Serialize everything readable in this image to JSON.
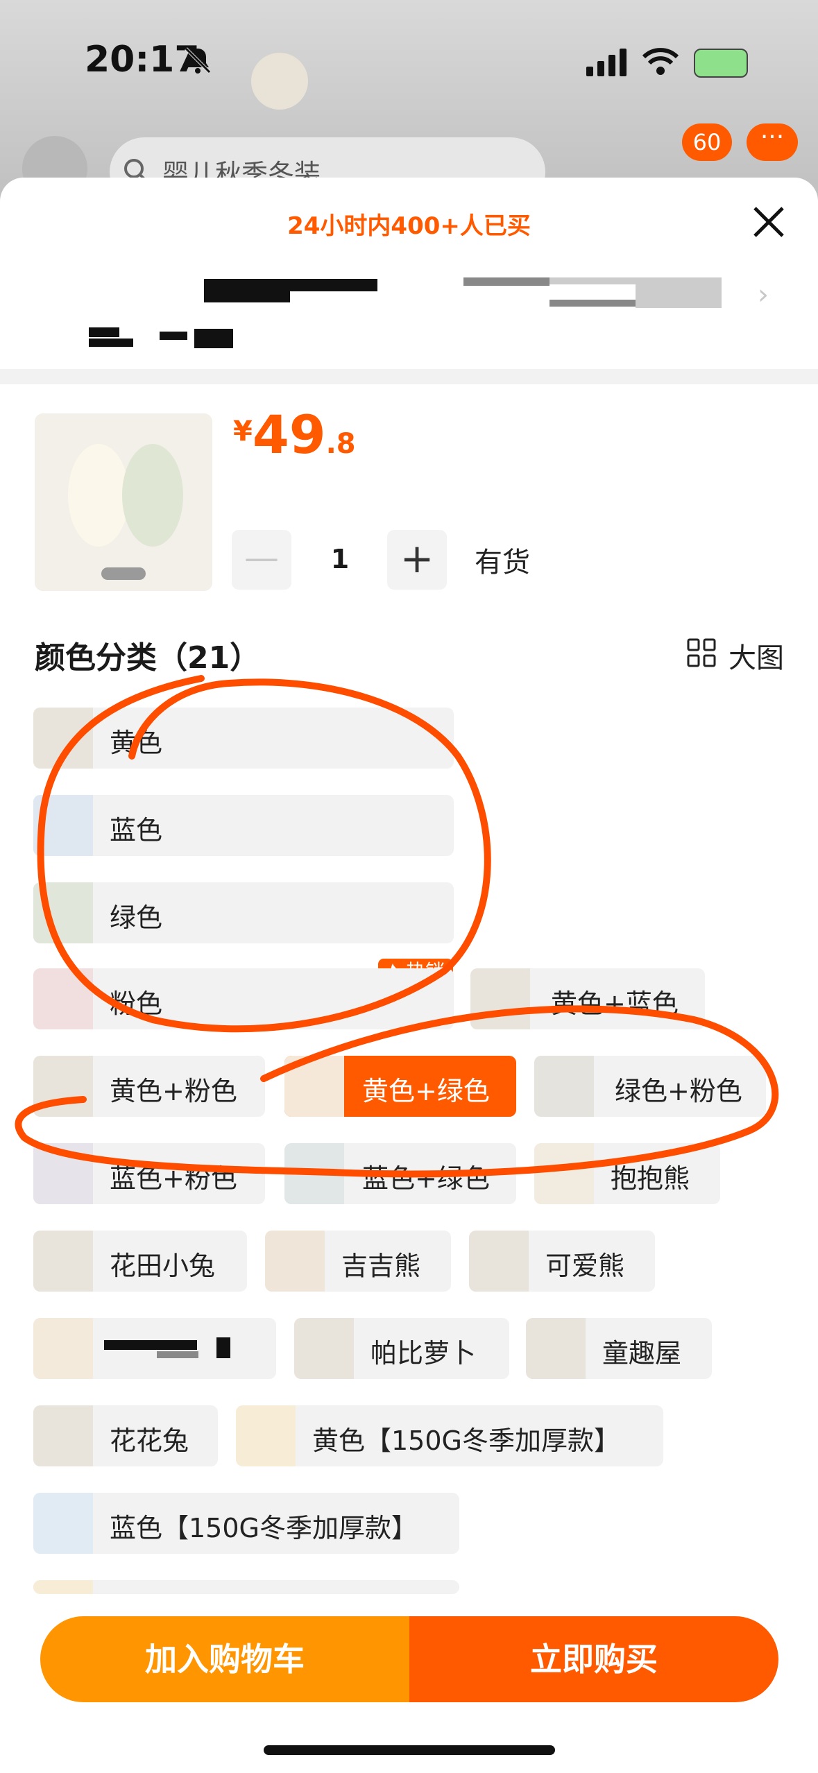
{
  "status_bar": {
    "time": "20:17"
  },
  "background_app": {
    "search_text": "婴儿秋季冬装",
    "cart_count": "60",
    "more": "···"
  },
  "sheet": {
    "banner": "24小时内400+人已买",
    "price": {
      "currency": "¥",
      "integer": "49",
      "decimal": ".8"
    },
    "product_thumb_label": "黄色+绿色",
    "quantity": "1",
    "stock": "有货",
    "section_title": "颜色分类（21）",
    "big_image_label": "大图",
    "hot_badge": "热销",
    "options": [
      {
        "label": "黄色"
      },
      {
        "label": "蓝色"
      },
      {
        "label": "绿色"
      },
      {
        "label": "粉色"
      },
      {
        "label": "黄色+蓝色"
      },
      {
        "label": "黄色+粉色"
      },
      {
        "label": "黄色+绿色",
        "selected": true
      },
      {
        "label": "绿色+粉色"
      },
      {
        "label": "蓝色+粉色"
      },
      {
        "label": "蓝色+绿色"
      },
      {
        "label": "抱抱熊"
      },
      {
        "label": "花田小兔"
      },
      {
        "label": "吉吉熊"
      },
      {
        "label": "可爱熊"
      },
      {
        "label": ""
      },
      {
        "label": "帕比萝卜"
      },
      {
        "label": "童趣屋"
      },
      {
        "label": "花花兔"
      },
      {
        "label": "黄色【150G冬季加厚款】"
      },
      {
        "label": "蓝色【150G冬季加厚款】"
      }
    ],
    "buttons": {
      "add_to_cart": "加入购物车",
      "buy_now": "立即购买"
    }
  },
  "colors": {
    "accent": "#ff5a00",
    "cart": "#ff9500"
  }
}
